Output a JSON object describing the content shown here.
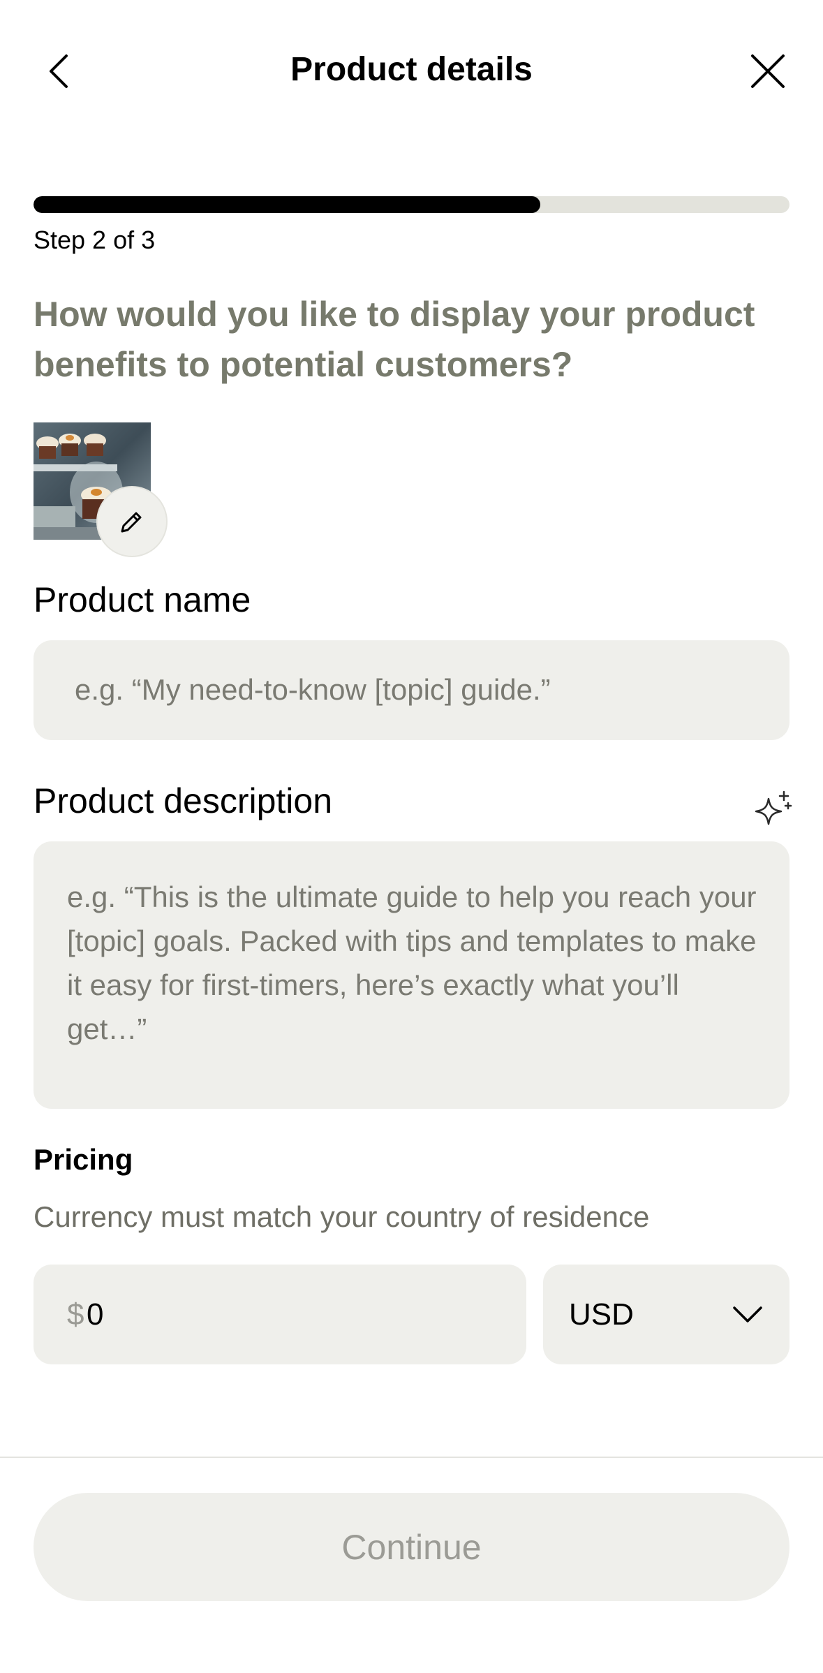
{
  "header": {
    "title": "Product details",
    "back_icon": "chevron-left-icon",
    "close_icon": "close-icon"
  },
  "progress": {
    "step_label": "Step 2 of 3",
    "fraction": 0.67,
    "fill_color": "#000000",
    "track_color": "#e3e3dc"
  },
  "question": "How would you like to display your product benefits to potential customers?",
  "product_image": {
    "edit_icon": "pencil-icon"
  },
  "product_name": {
    "label": "Product name",
    "placeholder": "e.g. “My need-to-know [topic] guide.”",
    "value": ""
  },
  "product_description": {
    "label": "Product description",
    "ai_icon": "sparkle-icon",
    "placeholder": "e.g. “This is the ultimate guide to help you reach your [topic] goals. Packed with tips and templates to make it easy for first-timers, here’s exactly what you’ll get…”",
    "value": ""
  },
  "pricing": {
    "title": "Pricing",
    "subtitle": "Currency must match your country of residence",
    "currency_symbol": "$",
    "price_value": "0",
    "currency": "USD",
    "dropdown_icon": "chevron-down-icon"
  },
  "footer": {
    "continue_label": "Continue"
  },
  "colors": {
    "field_bg": "#efefeb",
    "question_text": "#777a6c",
    "muted_text": "#6f6f66"
  }
}
